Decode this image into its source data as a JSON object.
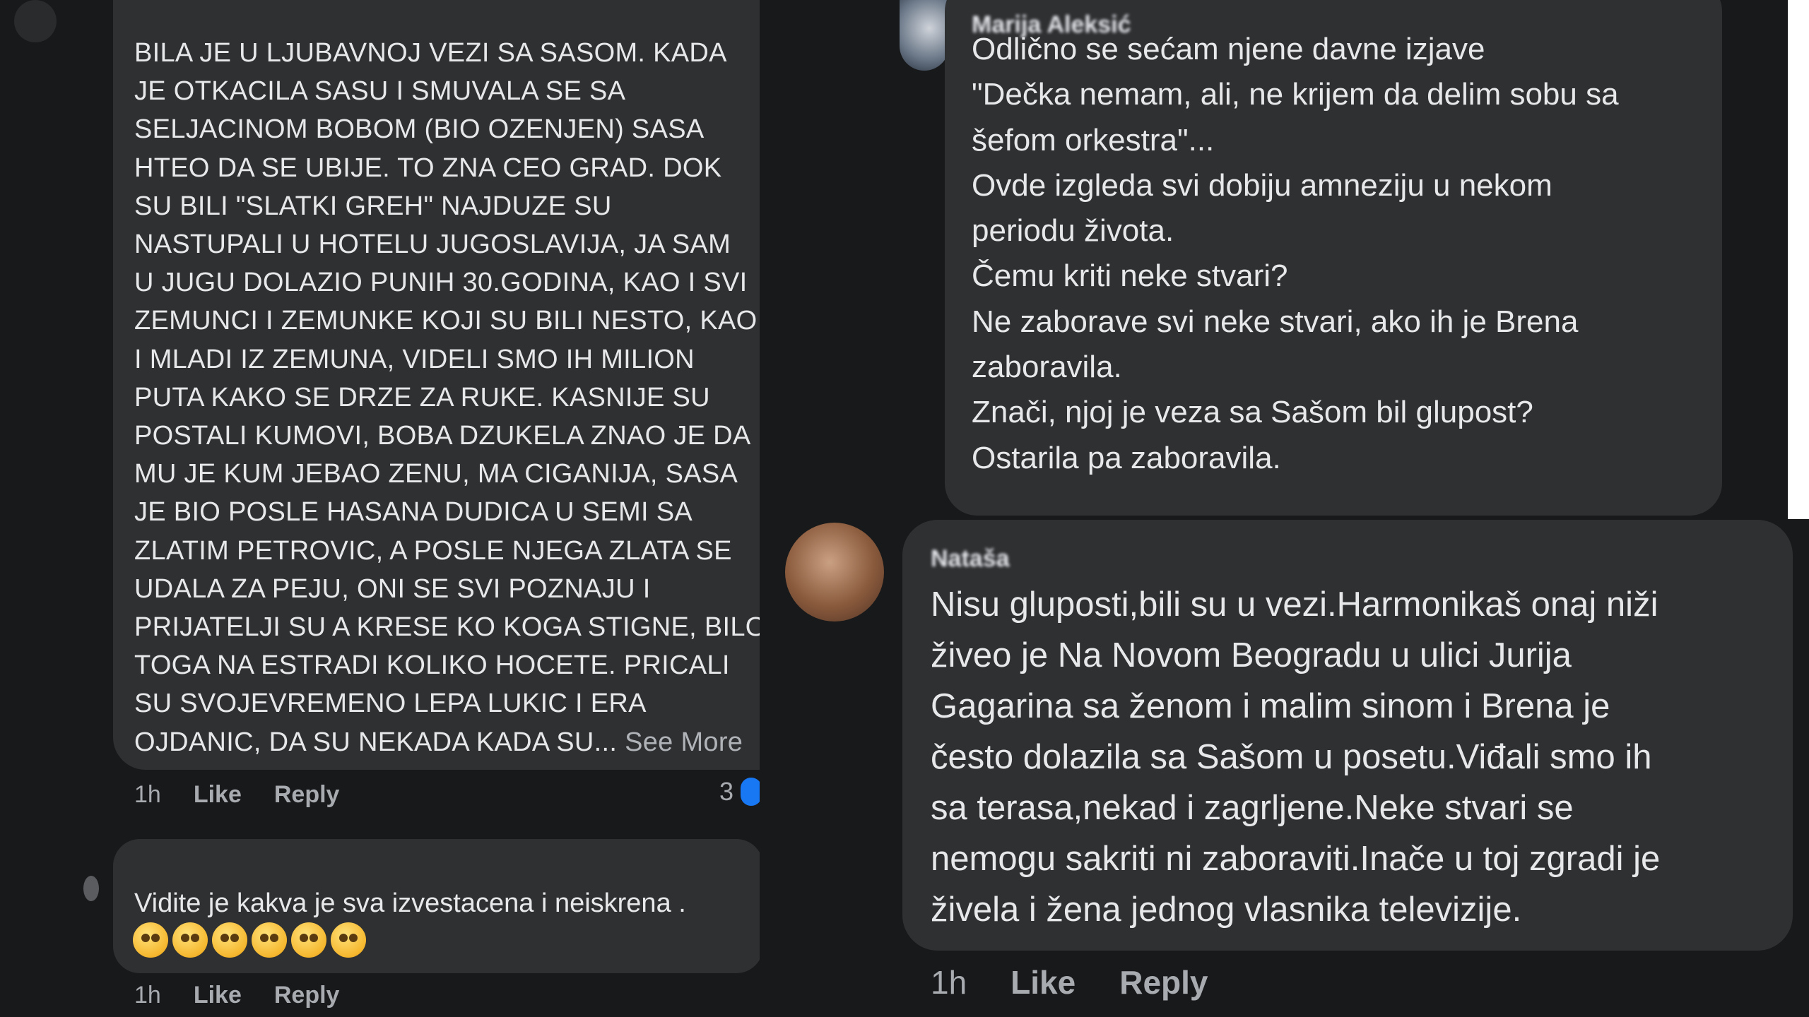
{
  "left": {
    "comment1": {
      "author": "",
      "body": "BILA JE U LJUBAVNOJ VEZI SA SASOM. KADA\nJE OTKACILA SASU I SMUVALA SE SA\nSELJACINOM BOBOM (BIO OZENJEN) SASA\nHTEO DA SE UBIJE. TO ZNA CEO GRAD. DOK\nSU BILI \"SLATKI GREH\" NAJDUZE SU\nNASTUPALI U HOTELU JUGOSLAVIJA, JA SAM\nU JUGU DOLAZIO PUNIH 30.GODINA, KAO I SVI\nZEMUNCI I ZEMUNKE KOJI SU BILI NESTO, KAO\nI MLADI IZ ZEMUNA, VIDELI SMO IH MILION\nPUTA KAKO SE DRZE ZA RUKE. KASNIJE SU\nPOSTALI KUMOVI, BOBA DZUKELA ZNAO JE DA\nMU JE KUM JEBAO ZENU, MA CIGANIJA, SASA\nJE BIO POSLE HASANA DUDICA U SEMI SA\nZLATIM PETROVIC, A POSLE NJEGA ZLATA SE\nUDALA ZA PEJU, ONI SE SVI POZNAJU I\nPRIJATELJI SU A KRESE KO KOGA STIGNE, BILO\nTOGA NA ESTRADI KOLIKO HOCETE. PRICALI\nSU SVOJEVREMENO LEPA LUKIC I ERA\nOJDANIC, DA SU NEKADA KADA SU...",
      "see_more": "See More",
      "time": "1h",
      "like": "Like",
      "reply": "Reply",
      "reaction_count": "3"
    },
    "comment2": {
      "author": "",
      "body": "Vidite je kakva je sva  izvestacena i neiskrena .",
      "emojis": [
        "face-with-monocle",
        "face-with-monocle",
        "face-with-monocle",
        "thinking-face",
        "thinking-face",
        "thinking-face"
      ],
      "time": "1h",
      "like": "Like",
      "reply": "Reply"
    }
  },
  "right": {
    "comment1": {
      "author": "Marija Aleksić",
      "body": "Odlično se sećam njene davne izjave\n\"Dečka nemam, ali, ne krijem da delim sobu sa\nšefom orkestra\"...\nOvde izgleda svi dobiju amneziju u nekom\nperiodu života.\nČemu kriti neke stvari?\nNe zaborave svi neke stvari, ako ih je Brena\nzaboravila.\nZnači, njoj je veza sa Sašom bil glupost?\nOstarila pa zaboravila."
    },
    "comment2": {
      "author": "Nataša",
      "body": "Nisu gluposti,bili su u vezi.Harmonikaš onaj niži\nživeo je Na Novom Beogradu u ulici Jurija\nGagarina sa ženom i malim sinom i Brena je\nčesto dolazila sa Sašom u posetu.Viđali smo ih\nsa terasa,nekad i zagrljene.Neke stvari se\nnemogu sakriti ni zaboraviti.Inače u toj zgradi je\nživela i žena jednog vlasnika televizije.",
      "time": "1h",
      "like": "Like",
      "reply": "Reply"
    }
  },
  "colors": {
    "background": "#18191b",
    "bubble": "#2f3032",
    "text": "#e7e8ea",
    "muted": "#a8abb0",
    "reaction_blue": "#1877f2"
  }
}
